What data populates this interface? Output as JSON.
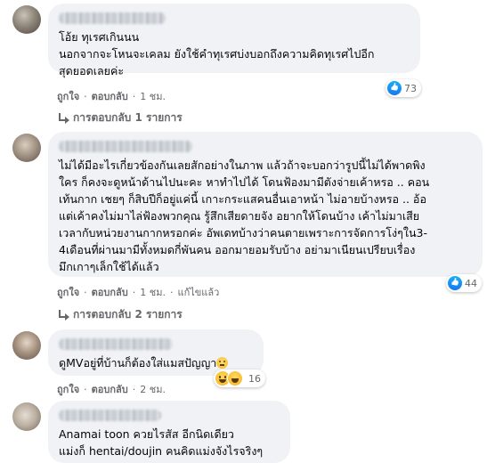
{
  "colors": {
    "bubble": "#f0f2f5",
    "meta": "#65676b",
    "like": "#1877f2"
  },
  "actions": {
    "like": "ถูกใจ",
    "reply": "ตอบกลับ",
    "dot": "·",
    "edited": "แก้ไขแล้ว"
  },
  "comments": [
    {
      "text": "โอ้ย ทุเรศเกินนน\nนอกจากจะโหนจะเคลม ยังใช้คำทุเรศบ่งบอกถึงความคิดทุเรศไปอีก\nสุดยอดเลยค่ะ",
      "time": "1 ชม.",
      "reaction_count": "73",
      "reaction_icons": [
        "like-icon"
      ],
      "replies_label": "การตอบกลับ 1 รายการ"
    },
    {
      "text": "ไม่ได้มีอะไรเกี่ยวข้องกันเลยสักอย่างในภาพ แล้วถ้าจะบอกว่ารูปนี้ไม่ได้พาดพิง\nใคร ก็คงจะดูหน้าด้านไปนะคะ หาทำไปได้ โดนฟ้องมามีตังจ่ายเค้าหรอ .. คอน\nเท้นกาก เชยๆ ก็สิบปีก็อยู่แค่นี้ เกาะกระแสคนอื่นเอาหน้า ไม่อายบ้างหรอ .. อ้อ\nแต่เค้าคงไม่มาไล่ฟ้องพวกคุณ รู้สึกเสียดายจัง อยากให้โดนบ้าง เค้าไม่มาเสีย\nเวลากับหน่วยงานกากหรอกค่ะ อัพเดทบ้างว่าคนตายเพราะการจัดการโง่ๆใน3-\n4เดือนที่ผ่านมามีทั้งหมดกี่พันคน ออกมายอมรับบ้าง อย่ามาเนียนเปรียบเรื่อง\nมึกเกาๆเล็กใช้ได้แล้ว",
      "time": "1 ชม.",
      "edited": true,
      "reaction_count": "44",
      "reaction_icons": [
        "like-icon"
      ],
      "replies_label": "การตอบกลับ 2 รายการ"
    },
    {
      "text": "ดูMVอยู่ที่บ้านก็ต้องใส่แมสปัญญา",
      "emoji": "grimacing-face",
      "time": "2 ชม.",
      "reaction_count": "16",
      "reaction_icons": [
        "grin-icon",
        "haha-icon"
      ]
    },
    {
      "text": "Anamai toon ควยไรสัส อีกนิดเดียว\nแม่งก็ hentai/doujin คนคิดแม่งจังไรจริงๆ",
      "time": ""
    }
  ]
}
